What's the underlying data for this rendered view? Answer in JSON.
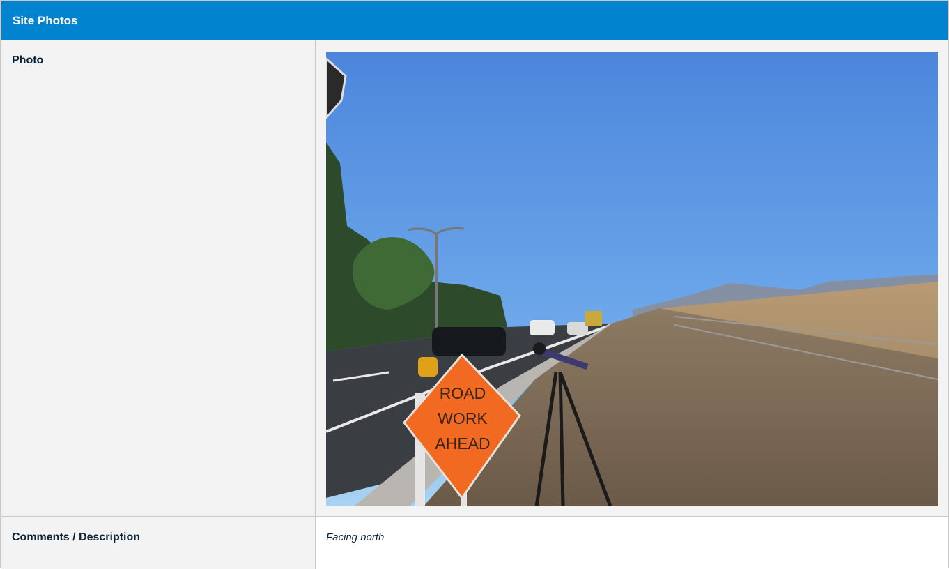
{
  "header": {
    "title": "Site Photos"
  },
  "photo_row": {
    "label": "Photo",
    "photo": {
      "sign_lines": [
        "ROAD",
        "WORK",
        "AHEAD"
      ]
    }
  },
  "comments_row": {
    "label": "Comments / Description",
    "value": "Facing north"
  },
  "colors": {
    "header_bg": "#0283cf",
    "label_text": "#0b2336",
    "cell_bg": "#f3f3f3",
    "border": "#c9c9c9",
    "sign_orange": "#f26a21"
  }
}
